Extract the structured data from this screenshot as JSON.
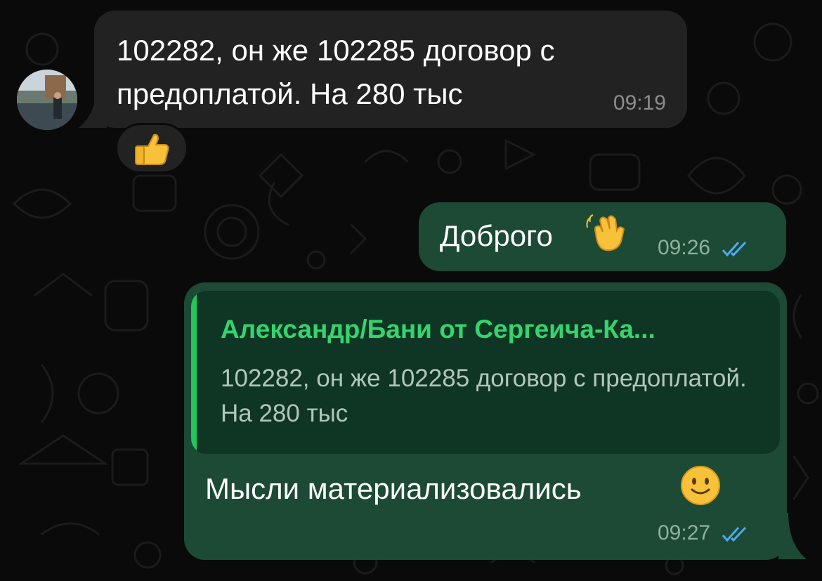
{
  "incoming_message": {
    "text": "102282, он же 102285 договор с предоплатой. На 280 тыс",
    "time": "09:19",
    "reaction": "thumbs-up"
  },
  "outgoing_messages": [
    {
      "text": "Доброго",
      "emoji": "waving-hand",
      "time": "09:26",
      "status": "read"
    },
    {
      "reply": {
        "sender": "Александр/Бани от Сергеича-Ка...",
        "text": "102282, он же 102285 договор с предоплатой. На 280 тыс"
      },
      "text": "Мысли материализовались",
      "emoji": "slightly-smiling-face",
      "time": "09:27",
      "status": "read"
    }
  ],
  "colors": {
    "background": "#0a0a0a",
    "incoming_bubble": "#222222",
    "outgoing_bubble": "#1c4a34",
    "reply_name": "#35d46d",
    "read_ticks": "#4fa9ef"
  }
}
